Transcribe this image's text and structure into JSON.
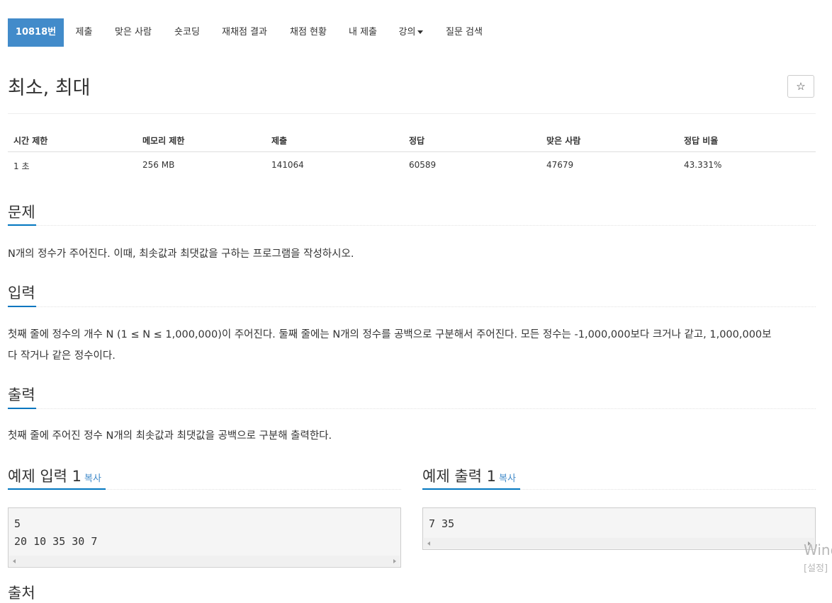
{
  "tabs": [
    {
      "label": "10818번",
      "active": true
    },
    {
      "label": "제출"
    },
    {
      "label": "맞은 사람"
    },
    {
      "label": "숏코딩"
    },
    {
      "label": "재채점 결과"
    },
    {
      "label": "채점 현황"
    },
    {
      "label": "내 제출"
    },
    {
      "label": "강의",
      "dropdown": true
    },
    {
      "label": "질문 검색"
    }
  ],
  "problem": {
    "title": "최소, 최대",
    "star_icon": "star-icon"
  },
  "info_table": {
    "headers": [
      "시간 제한",
      "메모리 제한",
      "제출",
      "정답",
      "맞은 사람",
      "정답 비율"
    ],
    "values": [
      "1 초",
      "256 MB",
      "141064",
      "60589",
      "47679",
      "43.331%"
    ]
  },
  "sections": {
    "description": {
      "heading": "문제",
      "text": "N개의 정수가 주어진다. 이때, 최솟값과 최댓값을 구하는 프로그램을 작성하시오."
    },
    "input": {
      "heading": "입력",
      "line1": "첫째 줄에 정수의 개수 N (1 ≤ N ≤ 1,000,000)이 주어진다. 둘째 줄에는 N개의 정수를 공백으로 구분해서 주어진다. 모든 정수는 -1,000,000보다 크거나 같고, 1,000,000보",
      "line2": "다 작거나 같은 정수이다."
    },
    "output": {
      "heading": "출력",
      "text": "첫째 줄에 주어진 정수 N개의 최솟값과 최댓값을 공백으로 구분해 출력한다."
    }
  },
  "samples": {
    "input": {
      "heading": "예제 입력 1",
      "copy_label": "복사",
      "lines": [
        "5",
        "20 10 35 30 7"
      ]
    },
    "output": {
      "heading": "예제 출력 1",
      "copy_label": "복사",
      "lines": [
        "7 35"
      ]
    }
  },
  "next_heading_partial": "출처",
  "watermark": {
    "line1": "Wind",
    "line2": "[설정]"
  },
  "colors": {
    "accent": "#428bca",
    "section_underline": "#0076c0"
  }
}
